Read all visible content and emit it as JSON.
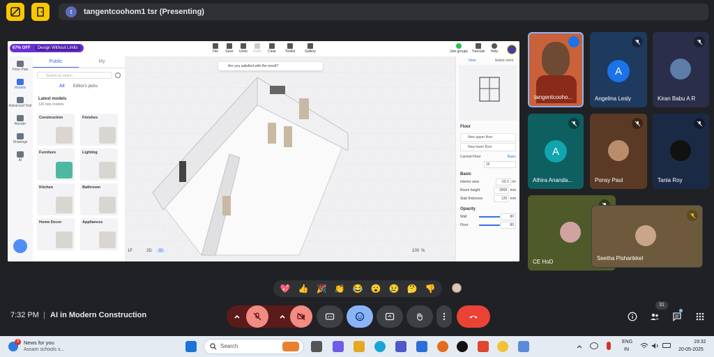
{
  "top": {
    "presenter_initial": "t",
    "presenter_text": "tangentcoohom1 tsr (Presenting)"
  },
  "shared": {
    "promo_off": "67% OFF",
    "promo_text": "Design Without Limits",
    "toolbar": [
      "File",
      "Save",
      "Undo",
      "Redo",
      "Clear",
      "Toolkit",
      "Gallery"
    ],
    "toolbar_right": [
      "Join groups",
      "Tutorials",
      "Help"
    ],
    "feedback": "Are you satisfied with the result?",
    "left_icons": [
      "Floor Plan",
      "Models",
      "Advanced Tool",
      "Render",
      "Drawings",
      "AI"
    ],
    "tabs": [
      "Public",
      "My"
    ],
    "search_placeholder": "Search by enteri...",
    "subtabs": [
      "All",
      "Editor's picks"
    ],
    "latest_title": "Latest models",
    "latest_sub": "120 new models",
    "categories": [
      "Construction",
      "Finishes",
      "Furniture",
      "Lighting",
      "Kitchen",
      "Bathroom",
      "Home Decor",
      "Appliances"
    ],
    "view_tabs": [
      "View",
      "Select room"
    ],
    "floor_title": "Floor",
    "new_upper": "New upper floor",
    "new_lower": "New lower floor",
    "current_floor_label": "Current Floor",
    "current_floor_link": "Basic",
    "current_floor_value": "1F",
    "basic_title": "Basic",
    "interior_area_label": "Interior area",
    "interior_area_value": "63.3",
    "interior_area_unit": "m²",
    "room_height_label": "Room height",
    "room_height_value": "2800",
    "room_height_unit": "mm",
    "slab_label": "Slab thickness",
    "slab_value": "120",
    "slab_unit": "mm",
    "opacity_title": "Opacity",
    "wall_label": "Wall",
    "wall_value": "80",
    "floor_label": "Floor",
    "floor_value": "80",
    "bottom_floor": "1F",
    "mode_2d": "2D",
    "mode_3d": "3D",
    "zoom": "100",
    "zoom_unit": "%"
  },
  "participants": [
    {
      "name": "tangentcooho...",
      "type": "video"
    },
    {
      "name": "Angelina Lesly",
      "initial": "A",
      "color": "#1a73e8"
    },
    {
      "name": "Kiran Babu A R",
      "type": "photo"
    },
    {
      "name": "Athira Ananda...",
      "initial": "A",
      "color": "#12a4af"
    },
    {
      "name": "Ponsy Paul",
      "type": "photo"
    },
    {
      "name": "Tania Roy",
      "type": "photo"
    },
    {
      "name": "CE HoD",
      "type": "photo"
    },
    {
      "name": "Seetha Pisharikkel",
      "type": "photo"
    }
  ],
  "reactions": [
    "💖",
    "👍",
    "🎉",
    "👏",
    "😂",
    "😮",
    "😢",
    "🤔",
    "👎"
  ],
  "bottom": {
    "time": "7:32 PM",
    "separator": "|",
    "meeting": "AI in Modern Construction",
    "people_count": "31"
  },
  "taskbar": {
    "news_badge": "3",
    "news_title": "News for you",
    "news_sub": "Assam schools s...",
    "search": "Search",
    "lang1": "ENG",
    "lang2": "IN",
    "time": "19:32",
    "date": "20-05-2025"
  },
  "colors": {
    "accent_yellow": "#f9c700",
    "end_call": "#ea4335",
    "muted_red": "#f28b82",
    "active_blue": "#8ab4f8"
  }
}
